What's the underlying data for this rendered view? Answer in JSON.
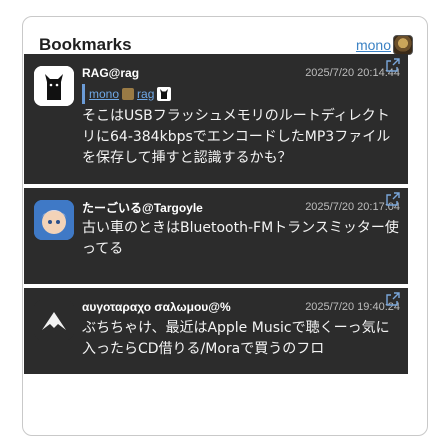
{
  "header": {
    "title": "Bookmarks",
    "account_name": "mono"
  },
  "posts": [
    {
      "author": "RAG@rag",
      "time": "2025/7/20 20:14:44",
      "quote": {
        "name": "mono",
        "handle": "rag"
      },
      "text": "そこはUSBフラッシュメモリのルートディレクトリに64-384kbpsでエンコードしたMP3ファイルを保存して挿すと認識するかも？"
    },
    {
      "author": "たーごいる@Targoyle",
      "time": "2025/7/20 20:17:04",
      "text": "古い車のときはBluetooth-FMトランスミッター使ってる"
    },
    {
      "author": "αυγοταραχο σαλωμου@%",
      "time": "2025/7/20 19:40:24",
      "text": "ぶちちゃけ、最近はApple Musicで聴くーっ気に入ったらCD借りる/Moraで買うのフロ"
    }
  ],
  "colors": {
    "card_bg": "#2c2c2c",
    "link": "#3b82c4"
  },
  "icons": [
    "cat-avatar-icon",
    "anime-avatar-icon",
    "bird-avatar-icon",
    "external-link-icon"
  ]
}
